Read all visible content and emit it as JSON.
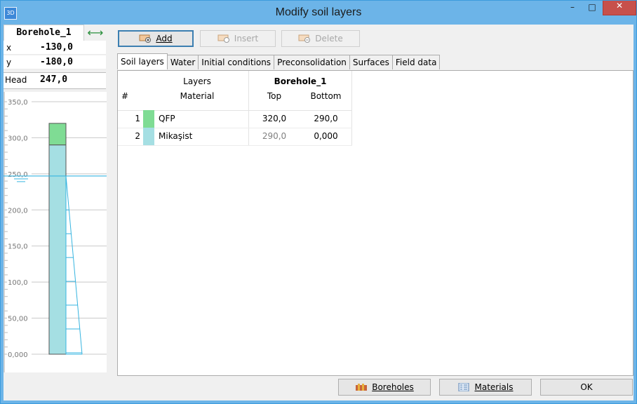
{
  "window": {
    "title": "Modify soil layers",
    "app_icon_text": "3D"
  },
  "titlebar": {
    "minimize": "–",
    "maximize": "□",
    "close": "✕"
  },
  "borehole": {
    "name": "Borehole_1",
    "x_label": "x",
    "x_value": "-130,0",
    "y_label": "y",
    "y_value": "-180,0",
    "head_label": "Head",
    "head_value": "247,0"
  },
  "profile": {
    "ticks": [
      "350,0",
      "300,0",
      "250,0",
      "200,0",
      "150,0",
      "100,0",
      "50,00",
      "0,000"
    ],
    "head_level": 247.0,
    "layers": [
      {
        "top": 320.0,
        "bottom": 290.0,
        "color": "#7fdc94"
      },
      {
        "top": 290.0,
        "bottom": 0.0,
        "color": "#a5dfe3"
      }
    ]
  },
  "toolbar": {
    "add_label": "Add",
    "insert_label": "Insert",
    "delete_label": "Delete"
  },
  "tabs": [
    "Soil layers",
    "Water",
    "Initial conditions",
    "Preconsolidation",
    "Surfaces",
    "Field data"
  ],
  "table": {
    "group_layers": "Layers",
    "group_borehole": "Borehole_1",
    "col_num": "#",
    "col_material": "Material",
    "col_top": "Top",
    "col_bottom": "Bottom",
    "rows": [
      {
        "num": "1",
        "material": "QFP",
        "color": "#7fdc94",
        "top": "320,0",
        "bottom": "290,0"
      },
      {
        "num": "2",
        "material": "Mikaşist",
        "color": "#a5dfe3",
        "top": "290,0",
        "bottom": "0,000"
      }
    ]
  },
  "footer": {
    "boreholes_label": "Boreholes",
    "materials_label": "Materials",
    "ok_label": "OK"
  }
}
